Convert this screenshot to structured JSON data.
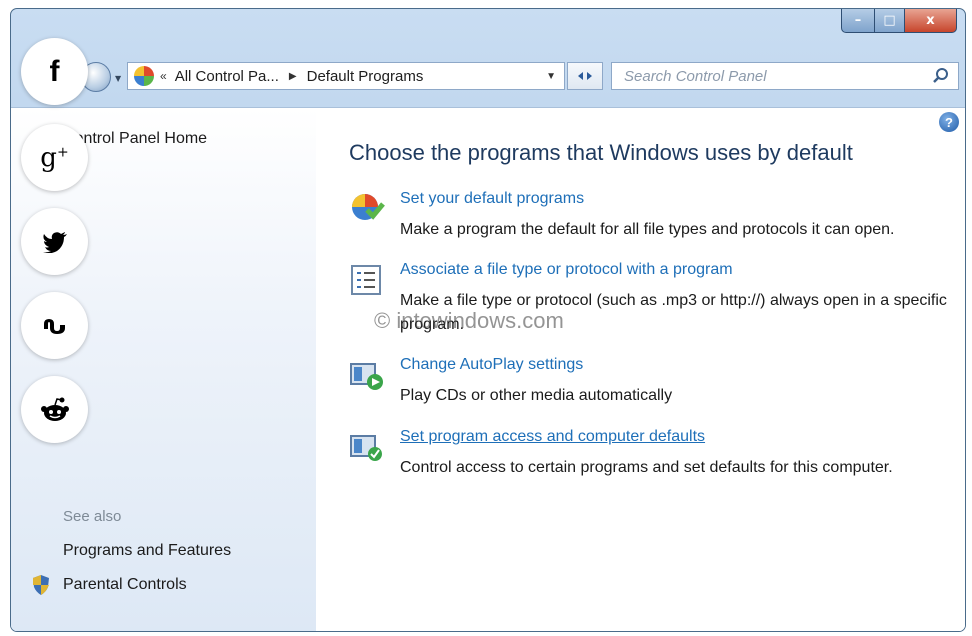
{
  "window": {
    "caption": {
      "minimize": "–",
      "maximize": "□",
      "close": "x"
    }
  },
  "navbar": {
    "breadcrumb_root": "All Control Pa...",
    "breadcrumb_current": "Default Programs",
    "search_placeholder": "Search Control Panel"
  },
  "left_pane": {
    "home_link": "Control Panel Home",
    "see_also_label": "See also",
    "links": [
      "Programs and Features",
      "Parental Controls"
    ]
  },
  "main": {
    "heading": "Choose the programs that Windows uses by default",
    "tasks": [
      {
        "link": "Set your default programs",
        "desc": "Make a program the default for all file types and protocols it can open.",
        "icon": "default-programs-icon"
      },
      {
        "link": "Associate a file type or protocol with a program",
        "desc": "Make a file type or protocol (such as .mp3 or http://) always open in a specific program.",
        "icon": "file-association-icon"
      },
      {
        "link": "Change AutoPlay settings",
        "desc": "Play CDs or other media automatically",
        "icon": "autoplay-icon"
      },
      {
        "link": "Set program access and computer defaults",
        "desc": "Control access to certain programs and set defaults for this computer.",
        "icon": "program-access-icon"
      }
    ],
    "watermark": "© intowindows.com"
  },
  "social": [
    {
      "name": "facebook",
      "glyph": "f"
    },
    {
      "name": "google-plus",
      "glyph": "g+"
    },
    {
      "name": "twitter",
      "glyph": "twitter"
    },
    {
      "name": "stumbleupon",
      "glyph": "su"
    },
    {
      "name": "reddit",
      "glyph": "reddit"
    }
  ]
}
